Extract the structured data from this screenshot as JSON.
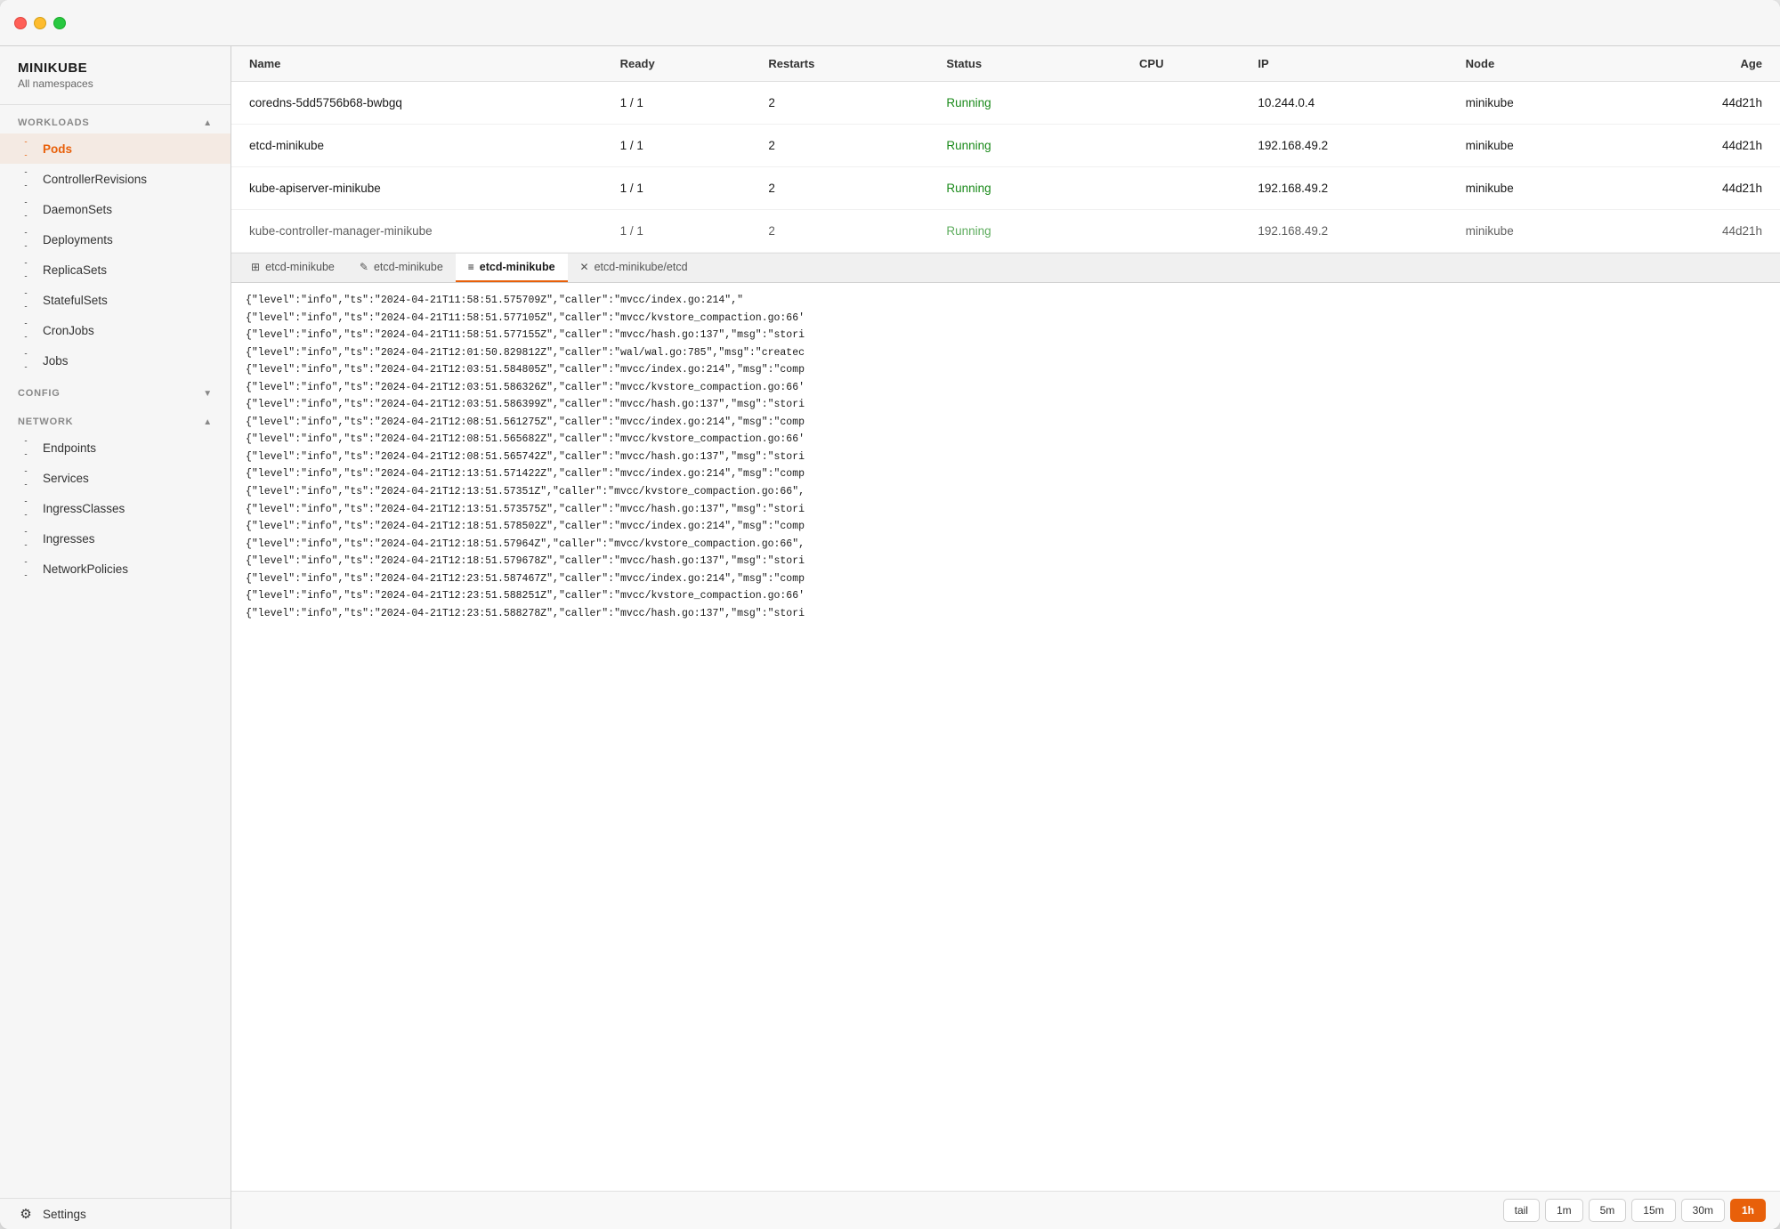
{
  "brand": {
    "name": "MINIKUBE",
    "subtitle": "All namespaces"
  },
  "sidebar": {
    "workloads_label": "WORKLOADS",
    "config_label": "CONFIG",
    "network_label": "NETWORK",
    "items_workloads": [
      {
        "id": "pods",
        "label": "Pods",
        "active": true
      },
      {
        "id": "controller-revisions",
        "label": "ControllerRevisions",
        "active": false
      },
      {
        "id": "daemon-sets",
        "label": "DaemonSets",
        "active": false
      },
      {
        "id": "deployments",
        "label": "Deployments",
        "active": false
      },
      {
        "id": "replica-sets",
        "label": "ReplicaSets",
        "active": false
      },
      {
        "id": "stateful-sets",
        "label": "StatefulSets",
        "active": false
      },
      {
        "id": "cron-jobs",
        "label": "CronJobs",
        "active": false
      },
      {
        "id": "jobs",
        "label": "Jobs",
        "active": false
      }
    ],
    "items_network": [
      {
        "id": "endpoints",
        "label": "Endpoints",
        "active": false
      },
      {
        "id": "services",
        "label": "Services",
        "active": false
      },
      {
        "id": "ingress-classes",
        "label": "IngressClasses",
        "active": false
      },
      {
        "id": "ingresses",
        "label": "Ingresses",
        "active": false
      },
      {
        "id": "network-policies",
        "label": "NetworkPolicies",
        "active": false
      }
    ],
    "settings_label": "Settings"
  },
  "table": {
    "headers": {
      "name": "Name",
      "ready": "Ready",
      "restarts": "Restarts",
      "status": "Status",
      "cpu": "CPU",
      "ip": "IP",
      "node": "Node",
      "age": "Age"
    },
    "rows": [
      {
        "name": "coredns-5dd5756b68-bwbgq",
        "ready": "1 / 1",
        "restarts": "2",
        "status": "Running",
        "cpu": "",
        "ip": "10.244.0.4",
        "node": "minikube",
        "age": "44d21h"
      },
      {
        "name": "etcd-minikube",
        "ready": "1 / 1",
        "restarts": "2",
        "status": "Running",
        "cpu": "",
        "ip": "192.168.49.2",
        "node": "minikube",
        "age": "44d21h"
      },
      {
        "name": "kube-apiserver-minikube",
        "ready": "1 / 1",
        "restarts": "2",
        "status": "Running",
        "cpu": "",
        "ip": "192.168.49.2",
        "node": "minikube",
        "age": "44d21h"
      },
      {
        "name": "kube-controller-manager-minikube",
        "ready": "1 / 1",
        "restarts": "2",
        "status": "Running",
        "cpu": "",
        "ip": "192.168.49.2",
        "node": "minikube",
        "age": "44d21h",
        "faded": true
      }
    ]
  },
  "tabs": [
    {
      "id": "tab1",
      "label": "etcd-minikube",
      "icon": "grid",
      "active": false
    },
    {
      "id": "tab2",
      "label": "etcd-minikube",
      "icon": "pencil",
      "active": false
    },
    {
      "id": "tab3",
      "label": "etcd-minikube",
      "icon": "log",
      "active": true
    },
    {
      "id": "tab4",
      "label": "etcd-minikube/etcd",
      "icon": "close",
      "active": false
    }
  ],
  "logs": [
    "{\"level\":\"info\",\"ts\":\"2024-04-21T11:58:51.575709Z\",\"caller\":\"mvcc/index.go:214\",\"",
    "{\"level\":\"info\",\"ts\":\"2024-04-21T11:58:51.577105Z\",\"caller\":\"mvcc/kvstore_compaction.go:66'",
    "{\"level\":\"info\",\"ts\":\"2024-04-21T11:58:51.577155Z\",\"caller\":\"mvcc/hash.go:137\",\"msg\":\"stori",
    "{\"level\":\"info\",\"ts\":\"2024-04-21T12:01:50.829812Z\",\"caller\":\"wal/wal.go:785\",\"msg\":\"createc",
    "{\"level\":\"info\",\"ts\":\"2024-04-21T12:03:51.584805Z\",\"caller\":\"mvcc/index.go:214\",\"msg\":\"comp",
    "{\"level\":\"info\",\"ts\":\"2024-04-21T12:03:51.586326Z\",\"caller\":\"mvcc/kvstore_compaction.go:66'",
    "{\"level\":\"info\",\"ts\":\"2024-04-21T12:03:51.586399Z\",\"caller\":\"mvcc/hash.go:137\",\"msg\":\"stori",
    "{\"level\":\"info\",\"ts\":\"2024-04-21T12:08:51.561275Z\",\"caller\":\"mvcc/index.go:214\",\"msg\":\"comp",
    "{\"level\":\"info\",\"ts\":\"2024-04-21T12:08:51.565682Z\",\"caller\":\"mvcc/kvstore_compaction.go:66'",
    "{\"level\":\"info\",\"ts\":\"2024-04-21T12:08:51.565742Z\",\"caller\":\"mvcc/hash.go:137\",\"msg\":\"stori",
    "{\"level\":\"info\",\"ts\":\"2024-04-21T12:13:51.571422Z\",\"caller\":\"mvcc/index.go:214\",\"msg\":\"comp",
    "{\"level\":\"info\",\"ts\":\"2024-04-21T12:13:51.57351Z\",\"caller\":\"mvcc/kvstore_compaction.go:66\",",
    "{\"level\":\"info\",\"ts\":\"2024-04-21T12:13:51.573575Z\",\"caller\":\"mvcc/hash.go:137\",\"msg\":\"stori",
    "{\"level\":\"info\",\"ts\":\"2024-04-21T12:18:51.578502Z\",\"caller\":\"mvcc/index.go:214\",\"msg\":\"comp",
    "{\"level\":\"info\",\"ts\":\"2024-04-21T12:18:51.57964Z\",\"caller\":\"mvcc/kvstore_compaction.go:66\",",
    "{\"level\":\"info\",\"ts\":\"2024-04-21T12:18:51.579678Z\",\"caller\":\"mvcc/hash.go:137\",\"msg\":\"stori",
    "{\"level\":\"info\",\"ts\":\"2024-04-21T12:23:51.587467Z\",\"caller\":\"mvcc/index.go:214\",\"msg\":\"comp",
    "{\"level\":\"info\",\"ts\":\"2024-04-21T12:23:51.588251Z\",\"caller\":\"mvcc/kvstore_compaction.go:66'",
    "{\"level\":\"info\",\"ts\":\"2024-04-21T12:23:51.588278Z\",\"caller\":\"mvcc/hash.go:137\",\"msg\":\"stori"
  ],
  "time_controls": [
    {
      "id": "tail",
      "label": "tail",
      "active": false
    },
    {
      "id": "1m",
      "label": "1m",
      "active": false
    },
    {
      "id": "5m",
      "label": "5m",
      "active": false
    },
    {
      "id": "15m",
      "label": "15m",
      "active": false
    },
    {
      "id": "30m",
      "label": "30m",
      "active": false
    },
    {
      "id": "1h",
      "label": "1h",
      "active": true
    }
  ]
}
